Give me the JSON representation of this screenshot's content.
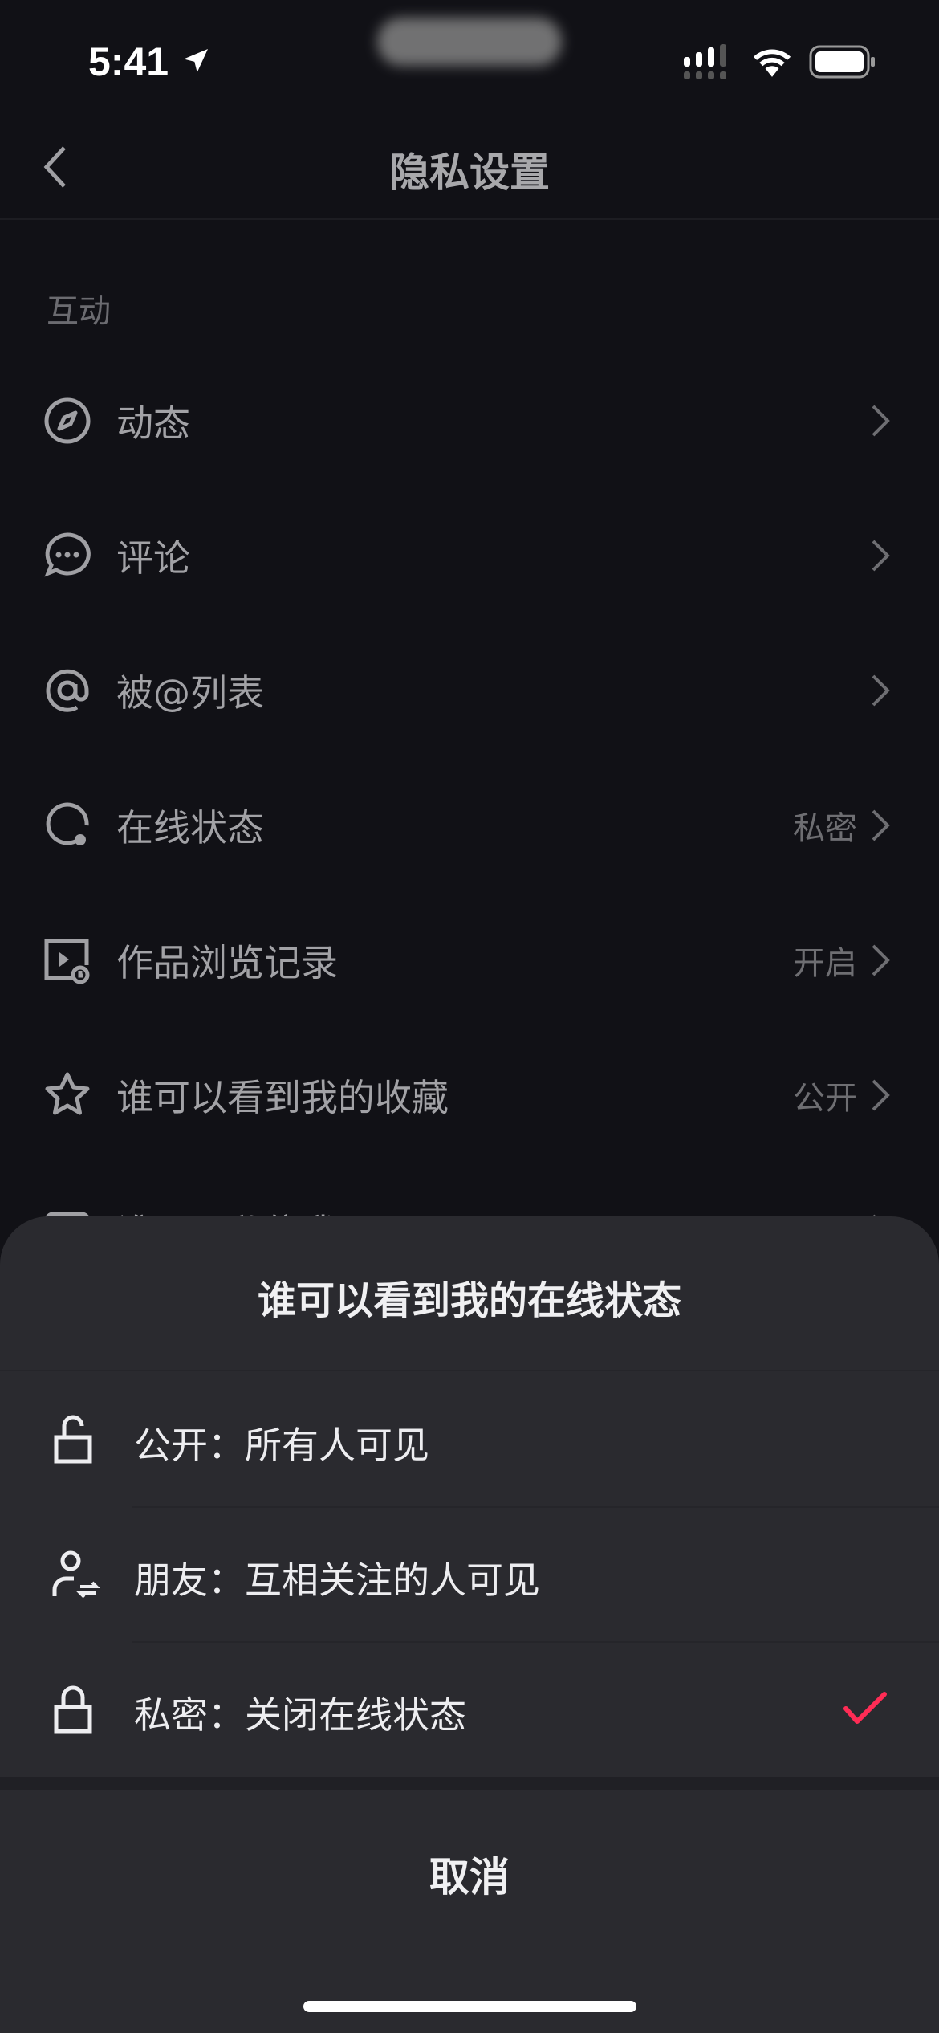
{
  "status_bar": {
    "time": "5:41",
    "icons": [
      "location-arrow-icon",
      "signal-icon",
      "wifi-icon",
      "battery-icon"
    ]
  },
  "header": {
    "title": "隐私设置",
    "back_icon": "chevron-left-icon"
  },
  "section": {
    "title": "互动"
  },
  "rows": [
    {
      "label": "动态",
      "value": "",
      "icon": "compass-icon"
    },
    {
      "label": "评论",
      "value": "",
      "icon": "comment-icon"
    },
    {
      "label": "被@列表",
      "value": "",
      "icon": "at-icon"
    },
    {
      "label": "在线状态",
      "value": "私密",
      "icon": "online-status-icon"
    },
    {
      "label": "作品浏览记录",
      "value": "开启",
      "icon": "video-history-icon"
    },
    {
      "label": "谁可以看到我的收藏",
      "value": "公开",
      "icon": "star-icon"
    },
    {
      "label": "谁可以私信我",
      "value": "",
      "icon": "message-icon"
    }
  ],
  "sheet": {
    "title": "谁可以看到我的在线状态",
    "options": [
      {
        "label": "公开：所有人可见",
        "icon": "unlock-icon",
        "selected": false
      },
      {
        "label": "朋友：互相关注的人可见",
        "icon": "friends-icon",
        "selected": false
      },
      {
        "label": "私密：关闭在线状态",
        "icon": "lock-icon",
        "selected": true
      }
    ],
    "cancel": "取消",
    "accent": "#fe2c55"
  }
}
